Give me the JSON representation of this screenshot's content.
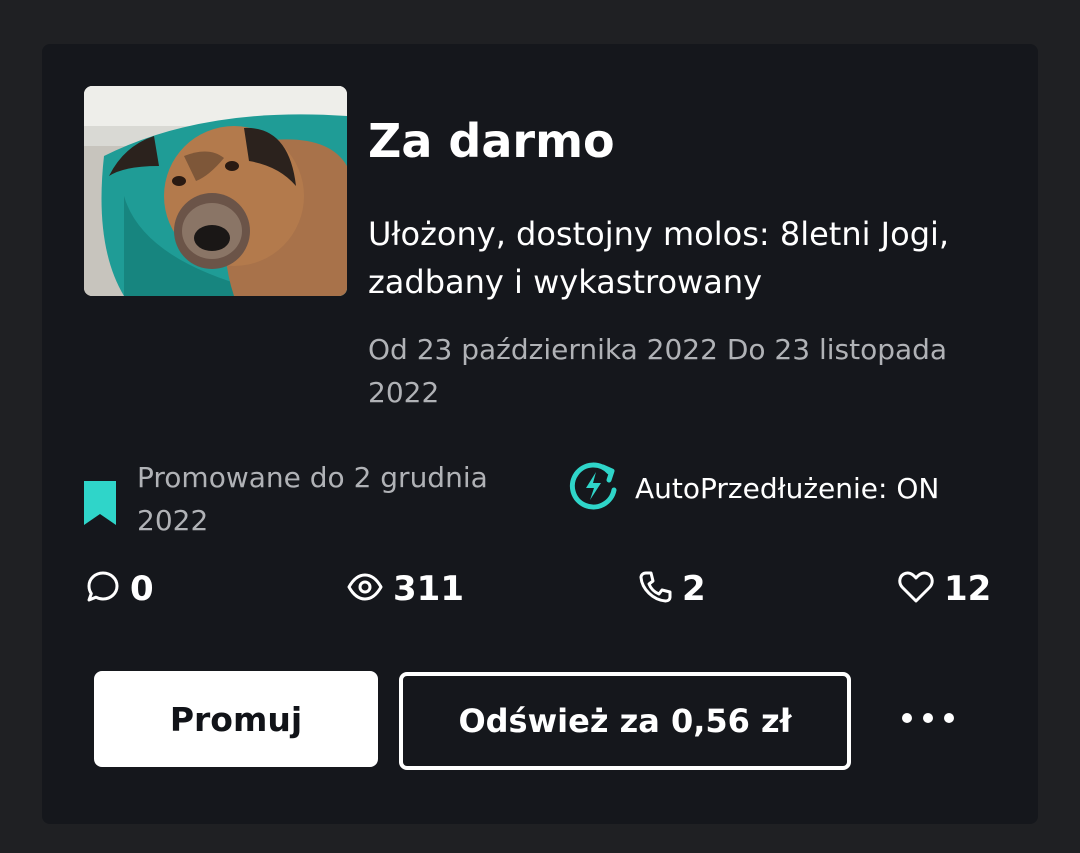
{
  "listing": {
    "price": "Za darmo",
    "title": "Ułożony, dostojny molos: 8letni Jogi, zadbany i wykastrowany",
    "dates": "Od 23 października 2022 Do 23 listopada 2022",
    "image_alt": "dog-photo"
  },
  "promotion": {
    "text": "Promowane do 2 grudnia 2022",
    "icon": "bookmark-icon",
    "color": "#2fd5c9"
  },
  "auto_renew": {
    "text": "AutoPrzedłużenie: ON",
    "icon": "auto-renew-icon",
    "color": "#2fd5c9"
  },
  "stats": {
    "messages": "0",
    "views": "311",
    "calls": "2",
    "favorites": "12"
  },
  "actions": {
    "promote_label": "Promuj",
    "refresh_label": "Odśwież za 0,56 zł",
    "more_icon": "more-icon"
  }
}
